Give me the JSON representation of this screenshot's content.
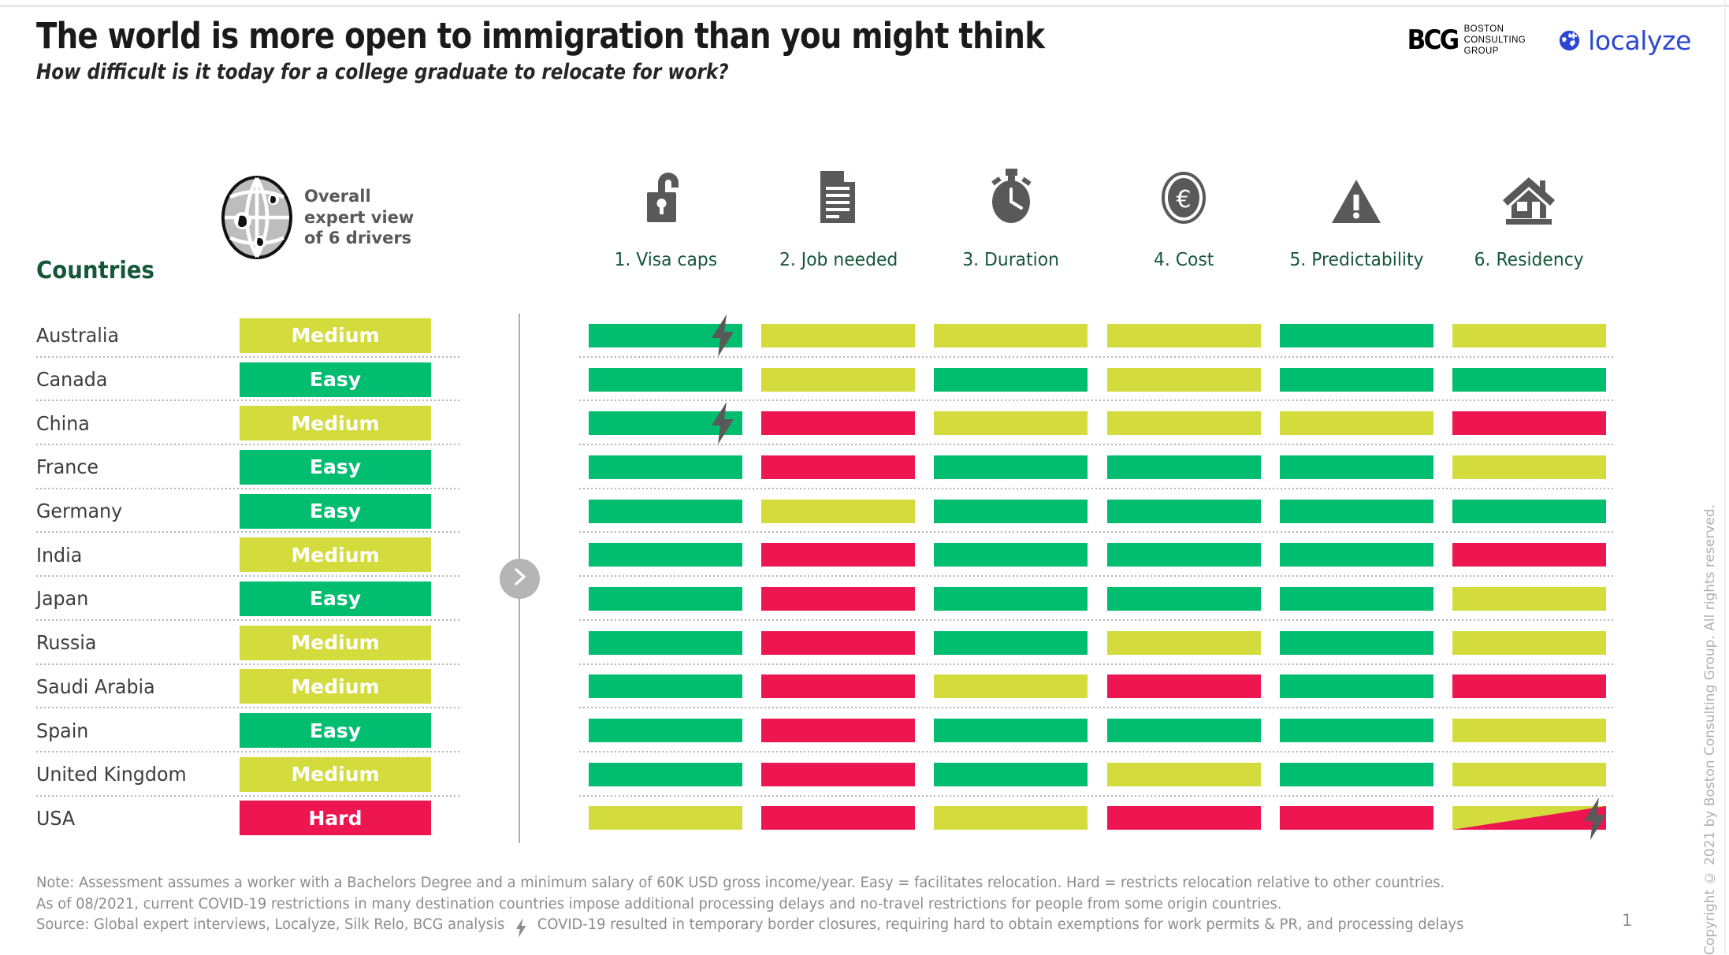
{
  "header": {
    "title": "The world is more open to immigration than you might think",
    "subtitle": "How difficult is it today for a college graduate to relocate for work?"
  },
  "logos": {
    "bcg_mark": "BCG",
    "bcg_words": "BOSTON\nCONSULTING\nGROUP",
    "localyze_word": "localyze"
  },
  "table_head": {
    "countries_label": "Countries",
    "overall_caption": "Overall\nexpert view\nof 6 drivers",
    "globe_icon": "globe-people-icon"
  },
  "drivers": [
    {
      "label": "1. Visa caps",
      "icon": "open-lock-icon"
    },
    {
      "label": "2. Job needed",
      "icon": "document-icon"
    },
    {
      "label": "3. Duration",
      "icon": "stopwatch-icon"
    },
    {
      "label": "4. Cost",
      "icon": "euro-coin-icon"
    },
    {
      "label": "5. Predictability",
      "icon": "warning-triangle-icon"
    },
    {
      "label": "6. Residency",
      "icon": "house-icon"
    }
  ],
  "legend_colors": {
    "easy": "#00bd70",
    "medium": "#d3dc3c",
    "hard": "#ed1651",
    "green_header": "#15573a",
    "icon_grey": "#595959"
  },
  "chart_data": {
    "type": "heatmap",
    "title": "The world is more open to immigration than you might think",
    "subtitle": "How difficult is it today for a college graduate to relocate for work?",
    "xlabel": "",
    "ylabel": "Countries",
    "categories": [
      "1. Visa caps",
      "2. Job needed",
      "3. Duration",
      "4. Cost",
      "5. Predictability",
      "6. Residency"
    ],
    "value_scale": [
      "Easy",
      "Medium",
      "Hard"
    ],
    "legend": "Easy = facilitates relocation. Hard = restricts relocation relative to other countries.",
    "rows": [
      {
        "country": "Australia",
        "overall": "Medium",
        "cells": [
          {
            "v": "Easy",
            "bolt": true
          },
          {
            "v": "Medium"
          },
          {
            "v": "Medium"
          },
          {
            "v": "Medium"
          },
          {
            "v": "Easy"
          },
          {
            "v": "Medium"
          }
        ]
      },
      {
        "country": "Canada",
        "overall": "Easy",
        "cells": [
          {
            "v": "Easy"
          },
          {
            "v": "Medium"
          },
          {
            "v": "Easy"
          },
          {
            "v": "Medium"
          },
          {
            "v": "Easy"
          },
          {
            "v": "Easy"
          }
        ]
      },
      {
        "country": "China",
        "overall": "Medium",
        "cells": [
          {
            "v": "Easy",
            "bolt": true
          },
          {
            "v": "Hard"
          },
          {
            "v": "Medium"
          },
          {
            "v": "Medium"
          },
          {
            "v": "Medium"
          },
          {
            "v": "Hard"
          }
        ]
      },
      {
        "country": "France",
        "overall": "Easy",
        "cells": [
          {
            "v": "Easy"
          },
          {
            "v": "Hard"
          },
          {
            "v": "Easy"
          },
          {
            "v": "Easy"
          },
          {
            "v": "Easy"
          },
          {
            "v": "Medium"
          }
        ]
      },
      {
        "country": "Germany",
        "overall": "Easy",
        "cells": [
          {
            "v": "Easy"
          },
          {
            "v": "Medium"
          },
          {
            "v": "Easy"
          },
          {
            "v": "Easy"
          },
          {
            "v": "Easy"
          },
          {
            "v": "Easy"
          }
        ]
      },
      {
        "country": "India",
        "overall": "Medium",
        "cells": [
          {
            "v": "Easy"
          },
          {
            "v": "Hard"
          },
          {
            "v": "Easy"
          },
          {
            "v": "Easy"
          },
          {
            "v": "Easy"
          },
          {
            "v": "Hard"
          }
        ]
      },
      {
        "country": "Japan",
        "overall": "Easy",
        "cells": [
          {
            "v": "Easy"
          },
          {
            "v": "Hard"
          },
          {
            "v": "Easy"
          },
          {
            "v": "Easy"
          },
          {
            "v": "Easy"
          },
          {
            "v": "Medium"
          }
        ]
      },
      {
        "country": "Russia",
        "overall": "Medium",
        "cells": [
          {
            "v": "Easy"
          },
          {
            "v": "Hard"
          },
          {
            "v": "Easy"
          },
          {
            "v": "Medium"
          },
          {
            "v": "Easy"
          },
          {
            "v": "Medium"
          }
        ]
      },
      {
        "country": "Saudi Arabia",
        "overall": "Medium",
        "cells": [
          {
            "v": "Easy"
          },
          {
            "v": "Hard"
          },
          {
            "v": "Medium"
          },
          {
            "v": "Hard"
          },
          {
            "v": "Easy"
          },
          {
            "v": "Hard"
          }
        ]
      },
      {
        "country": "Spain",
        "overall": "Easy",
        "cells": [
          {
            "v": "Easy"
          },
          {
            "v": "Hard"
          },
          {
            "v": "Easy"
          },
          {
            "v": "Easy"
          },
          {
            "v": "Easy"
          },
          {
            "v": "Medium"
          }
        ]
      },
      {
        "country": "United Kingdom",
        "overall": "Medium",
        "cells": [
          {
            "v": "Easy"
          },
          {
            "v": "Hard"
          },
          {
            "v": "Easy"
          },
          {
            "v": "Medium"
          },
          {
            "v": "Easy"
          },
          {
            "v": "Medium"
          }
        ]
      },
      {
        "country": "USA",
        "overall": "Hard",
        "cells": [
          {
            "v": "Medium"
          },
          {
            "v": "Hard"
          },
          {
            "v": "Medium"
          },
          {
            "v": "Hard"
          },
          {
            "v": "Hard"
          },
          {
            "v": "Medium-Hard",
            "split": true,
            "bolt": true
          }
        ]
      }
    ]
  },
  "footer": {
    "note_line1": "Note: Assessment assumes a worker with a Bachelors Degree and a minimum salary of 60K USD gross income/year. Easy = facilitates relocation. Hard = restricts relocation relative to other countries.",
    "note_line2": "As of 08/2021, current COVID-19 restrictions in many destination countries impose additional processing delays and no-travel restrictions for people from some origin countries.",
    "source_prefix": "Source: Global expert interviews, Localyze, Silk Relo, BCG analysis",
    "bolt_note": "COVID-19 resulted in temporary border closures, requiring hard to obtain exemptions for work permits & PR, and processing delays",
    "page_number": "1",
    "copyright": "Copyright © 2021 by Boston Consulting Group. All rights reserved."
  }
}
